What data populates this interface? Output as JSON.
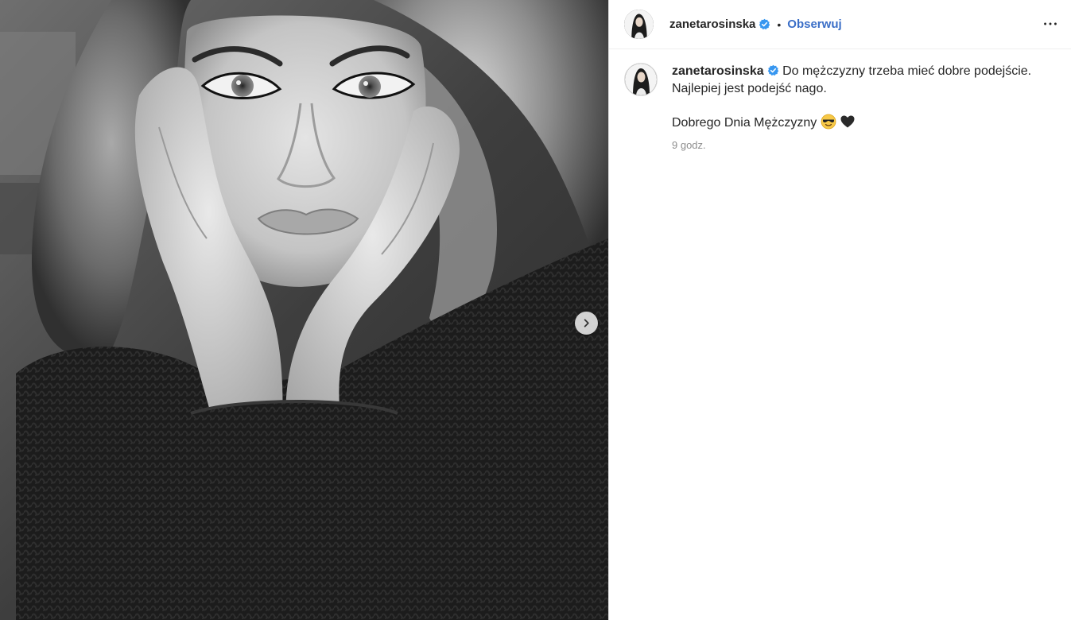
{
  "header": {
    "username": "zanetarosinska",
    "separator": "•",
    "follow_label": "Obserwuj",
    "verified_icon": "verified-badge-icon",
    "more_icon": "more-options-icon"
  },
  "caption": {
    "username": "zanetarosinska",
    "line1": "Do mężczyzny trzeba mieć dobre podejście.",
    "line2": "Najlepiej jest podejść nago.",
    "line3": "Dobrego Dnia Mężczyzny",
    "emojis": [
      "smiling-face-with-sunglasses",
      "black-heart"
    ],
    "timestamp": "9 godz."
  },
  "media": {
    "type": "black-and-white photo",
    "next_icon": "chevron-right-icon"
  },
  "colors": {
    "follow": "#3a6ec7",
    "verified": "#3897f0",
    "border": "#dbdbdb",
    "muted": "#8e8e8e"
  }
}
